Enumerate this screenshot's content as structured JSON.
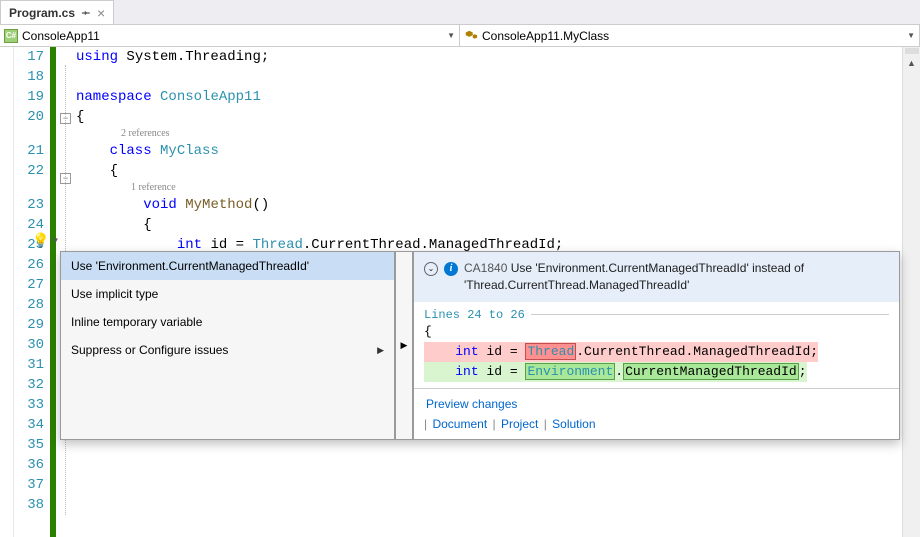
{
  "tab": {
    "name": "Program.cs",
    "close": "×"
  },
  "nav": {
    "left": "ConsoleApp11",
    "right": "ConsoleApp11.MyClass",
    "csIcon": "C#"
  },
  "lines": {
    "start": 17,
    "code": {
      "17": [
        [
          "kw",
          "using"
        ],
        [
          "txt",
          " System"
        ],
        [
          "txt",
          ".Threading;"
        ]
      ],
      "18": [],
      "19": [
        [
          "kw",
          "namespace"
        ],
        [
          "txt",
          " "
        ],
        [
          "ty",
          "ConsoleApp11"
        ]
      ],
      "20": [
        [
          "txt",
          "{"
        ]
      ],
      "ref1": "2 references",
      "21": [
        [
          "kw",
          "    class"
        ],
        [
          "txt",
          " "
        ],
        [
          "ty",
          "MyClass"
        ]
      ],
      "22": [
        [
          "txt",
          "    {"
        ]
      ],
      "ref2": "1 reference",
      "23": [
        [
          "txt",
          "        "
        ],
        [
          "kw",
          "void"
        ],
        [
          "txt",
          " "
        ],
        [
          "id",
          "MyMethod"
        ],
        [
          "txt",
          "()"
        ]
      ],
      "24": [
        [
          "txt",
          "        {"
        ]
      ],
      "25": [
        [
          "txt",
          "            "
        ],
        [
          "kw",
          "int"
        ],
        [
          "txt",
          " id = "
        ],
        [
          "ty",
          "Thread"
        ],
        [
          "txt",
          ".CurrentThread.ManagedThreadId;"
        ]
      ]
    }
  },
  "menu": {
    "items": [
      "Use 'Environment.CurrentManagedThreadId'",
      "Use implicit type",
      "Inline temporary variable",
      "Suppress or Configure issues"
    ]
  },
  "preview": {
    "ruleId": "CA1840",
    "ruleMsg": "Use 'Environment.CurrentManagedThreadId' instead of 'Thread.CurrentThread.ManagedThreadId'",
    "rangeLabel": "Lines 24 to 26",
    "brOpen": "{",
    "del": {
      "pre": "    ",
      "kw": "int",
      "mid": " id = ",
      "hl": "Thread",
      "rest": ".CurrentThread.ManagedThreadId",
      "semi": ";"
    },
    "add": {
      "pre": "    ",
      "kw": "int",
      "mid": " id = ",
      "hl": "Environment",
      "rest": ".",
      "hl2": "CurrentManagedThreadId",
      "semi": ";"
    },
    "footer": {
      "preview": "Preview changes",
      "doc": "Document",
      "proj": "Project",
      "sol": "Solution"
    }
  }
}
